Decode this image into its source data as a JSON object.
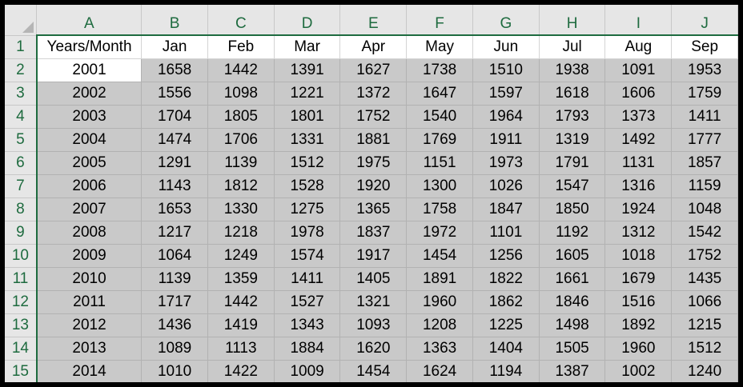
{
  "columns": [
    "A",
    "B",
    "C",
    "D",
    "E",
    "F",
    "G",
    "H",
    "I",
    "J"
  ],
  "header_row": {
    "row_number": "1",
    "cells": [
      "Years/Month",
      "Jan",
      "Feb",
      "Mar",
      "Apr",
      "May",
      "Jun",
      "Jul",
      "Aug",
      "Sep"
    ]
  },
  "rows": [
    {
      "row_number": "2",
      "cells": [
        "2001",
        "1658",
        "1442",
        "1391",
        "1627",
        "1738",
        "1510",
        "1938",
        "1091",
        "1953"
      ]
    },
    {
      "row_number": "3",
      "cells": [
        "2002",
        "1556",
        "1098",
        "1221",
        "1372",
        "1647",
        "1597",
        "1618",
        "1606",
        "1759"
      ]
    },
    {
      "row_number": "4",
      "cells": [
        "2003",
        "1704",
        "1805",
        "1801",
        "1752",
        "1540",
        "1964",
        "1793",
        "1373",
        "1411"
      ]
    },
    {
      "row_number": "5",
      "cells": [
        "2004",
        "1474",
        "1706",
        "1331",
        "1881",
        "1769",
        "1911",
        "1319",
        "1492",
        "1777"
      ]
    },
    {
      "row_number": "6",
      "cells": [
        "2005",
        "1291",
        "1139",
        "1512",
        "1975",
        "1151",
        "1973",
        "1791",
        "1131",
        "1857"
      ]
    },
    {
      "row_number": "7",
      "cells": [
        "2006",
        "1143",
        "1812",
        "1528",
        "1920",
        "1300",
        "1026",
        "1547",
        "1316",
        "1159"
      ]
    },
    {
      "row_number": "8",
      "cells": [
        "2007",
        "1653",
        "1330",
        "1275",
        "1365",
        "1758",
        "1847",
        "1850",
        "1924",
        "1048"
      ]
    },
    {
      "row_number": "9",
      "cells": [
        "2008",
        "1217",
        "1218",
        "1978",
        "1837",
        "1972",
        "1101",
        "1192",
        "1312",
        "1542"
      ]
    },
    {
      "row_number": "10",
      "cells": [
        "2009",
        "1064",
        "1249",
        "1574",
        "1917",
        "1454",
        "1256",
        "1605",
        "1018",
        "1752"
      ]
    },
    {
      "row_number": "11",
      "cells": [
        "2010",
        "1139",
        "1359",
        "1411",
        "1405",
        "1891",
        "1822",
        "1661",
        "1679",
        "1435"
      ]
    },
    {
      "row_number": "12",
      "cells": [
        "2011",
        "1717",
        "1442",
        "1527",
        "1321",
        "1960",
        "1862",
        "1846",
        "1516",
        "1066"
      ]
    },
    {
      "row_number": "13",
      "cells": [
        "2012",
        "1436",
        "1419",
        "1343",
        "1093",
        "1208",
        "1225",
        "1498",
        "1892",
        "1215"
      ]
    },
    {
      "row_number": "14",
      "cells": [
        "2013",
        "1089",
        "1113",
        "1884",
        "1620",
        "1363",
        "1404",
        "1505",
        "1960",
        "1512"
      ]
    },
    {
      "row_number": "15",
      "cells": [
        "2014",
        "1010",
        "1422",
        "1009",
        "1454",
        "1624",
        "1194",
        "1387",
        "1002",
        "1240"
      ]
    }
  ],
  "active_cell": "A2",
  "colors": {
    "header_accent": "#1e6b3f",
    "selection_fill": "#c9c9c9",
    "header_fill": "#e6e6e6"
  }
}
